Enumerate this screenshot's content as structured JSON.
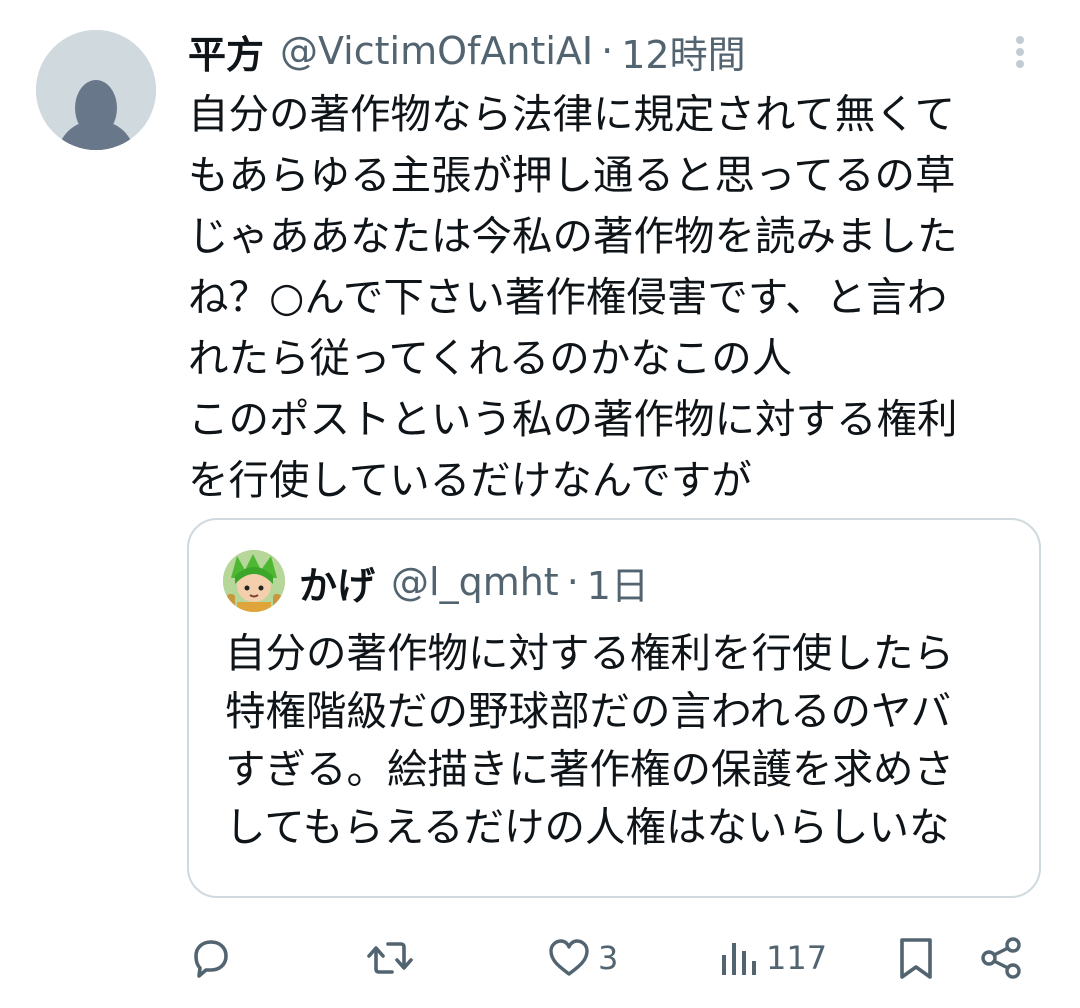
{
  "post": {
    "display_name": "平方",
    "handle": "@VictimOfAntiAI",
    "separator": "·",
    "time": "12時間",
    "text": "自分の著作物なら法律に規定されて無くて\nもあらゆる主張が押し通ると思ってるの草\nじゃああなたは今私の著作物を読みました\nね？○んで下さい著作権侵害です、と言わ\nれたら従ってくれるのかなこの人\nこのポストという私の著作物に対する権利\nを行使しているだけなんですが"
  },
  "quoted": {
    "display_name": "かげ",
    "handle": "@l_qmht",
    "separator": "·",
    "time": "1日",
    "text": "自分の著作物に対する権利を行使したら\n特権階級だの野球部だの言われるのヤバ\nすぎる。絵描きに著作権の保護を求めさ\nしてもらえるだけの人権はないらしいな"
  },
  "actions": {
    "reply_icon": "reply-icon",
    "repost_icon": "repost-icon",
    "like_icon": "heart-icon",
    "like_count": "3",
    "views_icon": "views-chart-icon",
    "views_count": "117",
    "bookmark_icon": "bookmark-icon",
    "share_icon": "share-icon"
  },
  "colors": {
    "text_primary": "#0f1419",
    "text_secondary": "#536471",
    "border": "#cfd9de",
    "avatar_bg": "#cfd9de",
    "avatar_figure": "#68788a"
  }
}
